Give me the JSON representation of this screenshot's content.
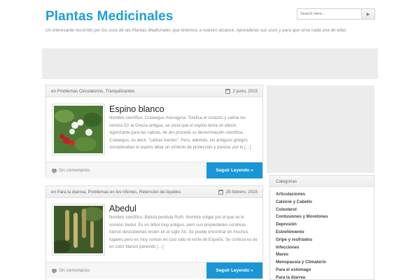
{
  "header": {
    "site_title": "Plantas Medicinales",
    "tagline": "Un interesante recorrido por los usos de las Plantas Medicinales que tenemos a nuestro alcance. Aprenderás sus usos y para que sirve cada una de ellas.",
    "search_placeholder": "Search Here...",
    "search_button_icon": "arrow-right-icon"
  },
  "posts": [
    {
      "categories": "en Problemas Circulatorios, Tranquilizantes",
      "date": "2 junio, 2015",
      "title": "Espino blanco",
      "excerpt": "Nombre científico: Crataegus monogyna. Tonifica el corazón y calma los nervios En la Grecia antigua, se creía que el espino tenía un efecto vigorizante para las cabras, de ahí procede su denominación científica, Crataegus, es decir, \"cabras fuertes\". Pero, además, los antiguos griegos consideraban el espino albar un símbolo de protección y pureza, por lo […]",
      "comments": "Sin comentarios",
      "read_more": "Seguir Leyendo »"
    },
    {
      "categories": "en Para la diarrea, Problemas en los riñones, Retención de líquidos",
      "date": "25 febrero, 2015",
      "title": "Abedul",
      "excerpt": "Nombre científico: Betula pendula Roth. Nombre vulgar por el que se le conoce: bedul. Es un árbol muy antiguo, pero sus propiedades curativas fueron descubiertas recién en el siglo XII. Se puede encontrar en muchos lugares pero es muy común en casi todo el norte de España. Su corteza es de un color blanco parecido […]",
      "comments": "Sin comentarios",
      "read_more": "Seguir Leyendo »"
    }
  ],
  "sidebar": {
    "categories_title": "Categorias",
    "categories": [
      "Articulaciones",
      "Calvicie y Cabello",
      "Colesterol",
      "Contusiones y Moretones",
      "Depresión",
      "Estreñimiento",
      "Gripe y resfriados",
      "Infecciones",
      "Mareo",
      "Menopausia y Climaterio",
      "Para el estómago",
      "Para la diarrea"
    ]
  },
  "colors": {
    "accent": "#1e9ed6",
    "button": "#1a96d6"
  }
}
